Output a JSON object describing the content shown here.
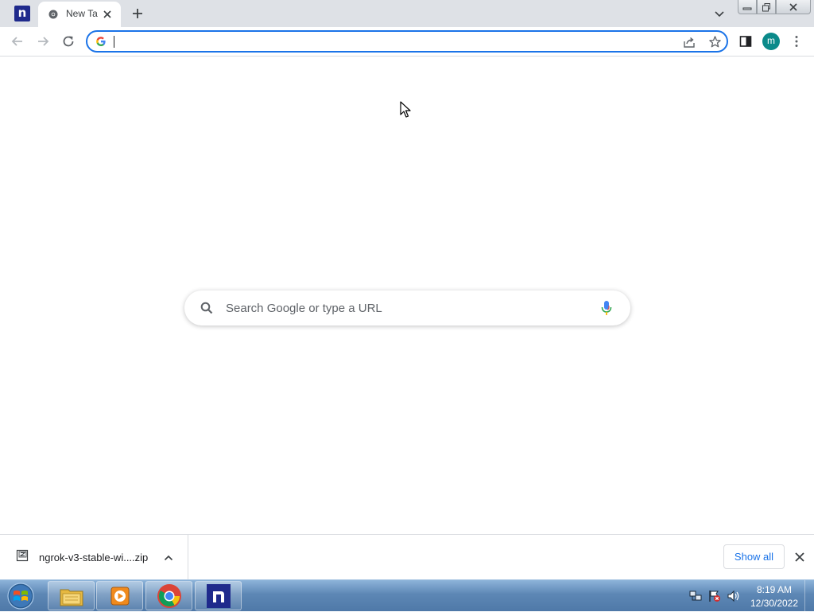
{
  "browser": {
    "tab": {
      "title": "New Tab"
    },
    "omnibox": {
      "value": "",
      "placeholder": ""
    },
    "profile_initial": "m"
  },
  "ntp": {
    "search_placeholder": "Search Google or type a URL"
  },
  "download_shelf": {
    "items": [
      {
        "name": "ngrok-v3-stable-wi....zip"
      }
    ],
    "show_all_label": "Show all"
  },
  "taskbar": {
    "apps": [
      "file-explorer",
      "media-player",
      "chrome",
      "pinned-n-app"
    ],
    "clock": {
      "time": "8:19 AM",
      "date": "12/30/2022"
    }
  },
  "colors": {
    "accent": "#1a73e8",
    "tabstrip": "#dee1e6",
    "avatar": "#0b8a8a",
    "pinned_app": "#1f2a8c"
  }
}
